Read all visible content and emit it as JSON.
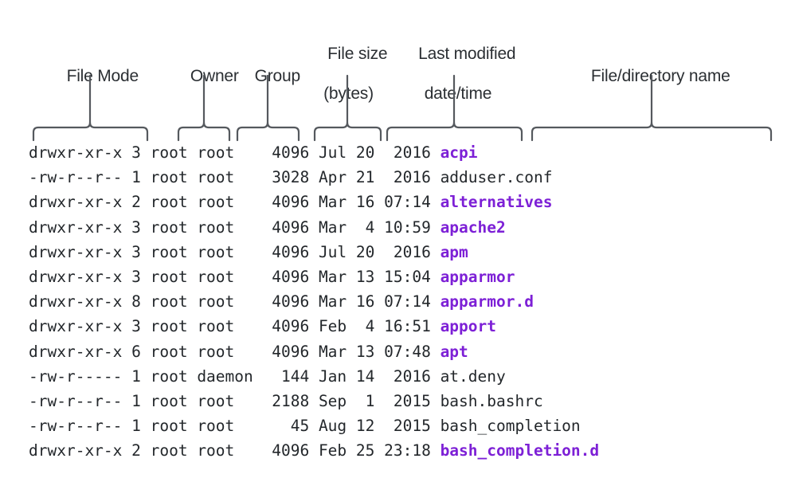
{
  "diagram": {
    "title_alt": "Anatomy of ls -l output",
    "colors": {
      "background": "#ffffff",
      "text": "#23272b",
      "header_text": "#2b2f33",
      "brace": "#55595e",
      "leader_line": "#55595e",
      "directory_name": "#7d20d6",
      "file_name": "#23272b"
    },
    "column_labels": [
      {
        "name": "file-mode",
        "line1": "File Mode",
        "line2": ""
      },
      {
        "name": "owner",
        "line1": "Owner",
        "line2": ""
      },
      {
        "name": "group",
        "line1": "Group",
        "line2": ""
      },
      {
        "name": "file-size",
        "line1": "File size",
        "line2": "(bytes)"
      },
      {
        "name": "last-modified",
        "line1": "Last modified",
        "line2": "date/time"
      },
      {
        "name": "file-name",
        "line1": "File/directory name",
        "line2": ""
      }
    ],
    "listing": {
      "columns": [
        "mode",
        "links",
        "owner",
        "group",
        "size",
        "month",
        "day",
        "time_or_year",
        "name"
      ],
      "rows": [
        {
          "mode": "drwxr-xr-x",
          "links": "3",
          "owner": "root",
          "group": "root",
          "size": "4096",
          "month": "Jul",
          "day": "20",
          "time_or_year": " 2016",
          "name": "acpi",
          "is_dir": true
        },
        {
          "mode": "-rw-r--r--",
          "links": "1",
          "owner": "root",
          "group": "root",
          "size": "3028",
          "month": "Apr",
          "day": "21",
          "time_or_year": " 2016",
          "name": "adduser.conf",
          "is_dir": false
        },
        {
          "mode": "drwxr-xr-x",
          "links": "2",
          "owner": "root",
          "group": "root",
          "size": "4096",
          "month": "Mar",
          "day": "16",
          "time_or_year": "07:14",
          "name": "alternatives",
          "is_dir": true
        },
        {
          "mode": "drwxr-xr-x",
          "links": "3",
          "owner": "root",
          "group": "root",
          "size": "4096",
          "month": "Mar",
          "day": " 4",
          "time_or_year": "10:59",
          "name": "apache2",
          "is_dir": true
        },
        {
          "mode": "drwxr-xr-x",
          "links": "3",
          "owner": "root",
          "group": "root",
          "size": "4096",
          "month": "Jul",
          "day": "20",
          "time_or_year": " 2016",
          "name": "apm",
          "is_dir": true
        },
        {
          "mode": "drwxr-xr-x",
          "links": "3",
          "owner": "root",
          "group": "root",
          "size": "4096",
          "month": "Mar",
          "day": "13",
          "time_or_year": "15:04",
          "name": "apparmor",
          "is_dir": true
        },
        {
          "mode": "drwxr-xr-x",
          "links": "8",
          "owner": "root",
          "group": "root",
          "size": "4096",
          "month": "Mar",
          "day": "16",
          "time_or_year": "07:14",
          "name": "apparmor.d",
          "is_dir": true
        },
        {
          "mode": "drwxr-xr-x",
          "links": "3",
          "owner": "root",
          "group": "root",
          "size": "4096",
          "month": "Feb",
          "day": " 4",
          "time_or_year": "16:51",
          "name": "apport",
          "is_dir": true
        },
        {
          "mode": "drwxr-xr-x",
          "links": "6",
          "owner": "root",
          "group": "root",
          "size": "4096",
          "month": "Mar",
          "day": "13",
          "time_or_year": "07:48",
          "name": "apt",
          "is_dir": true
        },
        {
          "mode": "-rw-r-----",
          "links": "1",
          "owner": "root",
          "group": "daemon",
          "size": " 144",
          "month": "Jan",
          "day": "14",
          "time_or_year": " 2016",
          "name": "at.deny",
          "is_dir": false
        },
        {
          "mode": "-rw-r--r--",
          "links": "1",
          "owner": "root",
          "group": "root",
          "size": "2188",
          "month": "Sep",
          "day": " 1",
          "time_or_year": " 2015",
          "name": "bash.bashrc",
          "is_dir": false
        },
        {
          "mode": "-rw-r--r--",
          "links": "1",
          "owner": "root",
          "group": "root",
          "size": "  45",
          "month": "Aug",
          "day": "12",
          "time_or_year": " 2015",
          "name": "bash_completion",
          "is_dir": false
        },
        {
          "mode": "drwxr-xr-x",
          "links": "2",
          "owner": "root",
          "group": "root",
          "size": "4096",
          "month": "Feb",
          "day": "25",
          "time_or_year": "23:18",
          "name": "bash_completion.d",
          "is_dir": true
        }
      ]
    }
  }
}
